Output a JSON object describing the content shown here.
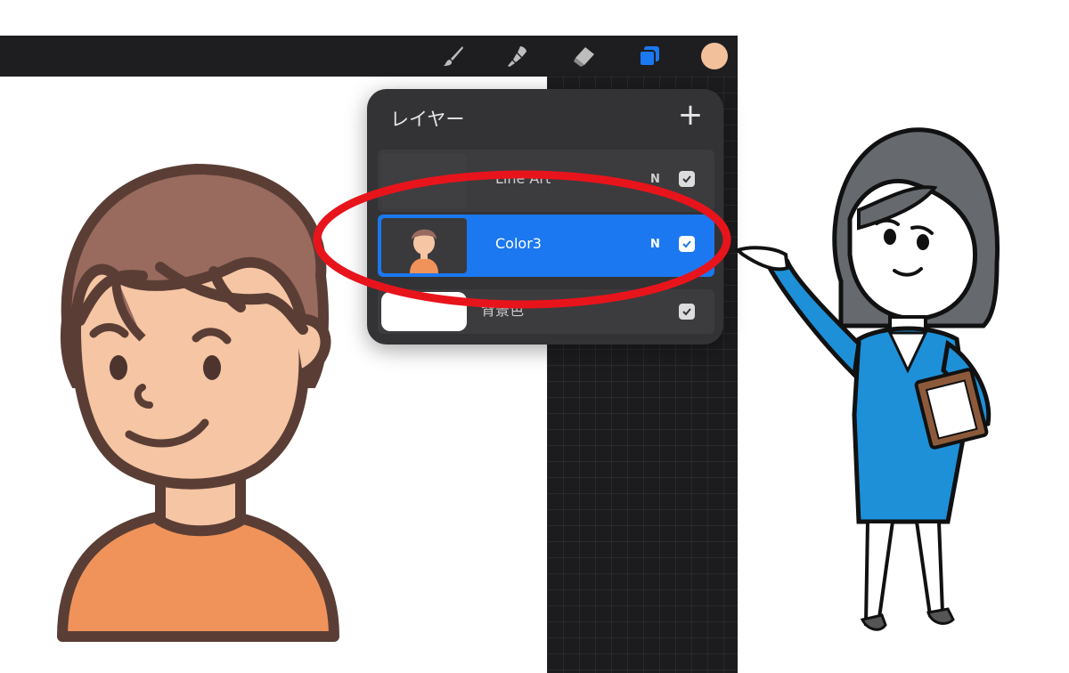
{
  "toolbar": {
    "tools": [
      "brush-icon",
      "smudge-icon",
      "eraser-icon",
      "layers-icon"
    ],
    "active_tool": "layers-icon",
    "active_color": "#f2c09a",
    "accent": "#1b78f0"
  },
  "layers_panel": {
    "title": "レイヤー",
    "add_symbol": "+",
    "layers": [
      {
        "name": "Line Art",
        "blend_mode": "N",
        "visible": true,
        "selected": false
      },
      {
        "name": "Color3",
        "blend_mode": "N",
        "visible": true,
        "selected": true
      },
      {
        "name": "背景色",
        "blend_mode": "",
        "visible": true,
        "selected": false
      }
    ]
  },
  "annotation": {
    "highlight_color": "#e8141c"
  }
}
